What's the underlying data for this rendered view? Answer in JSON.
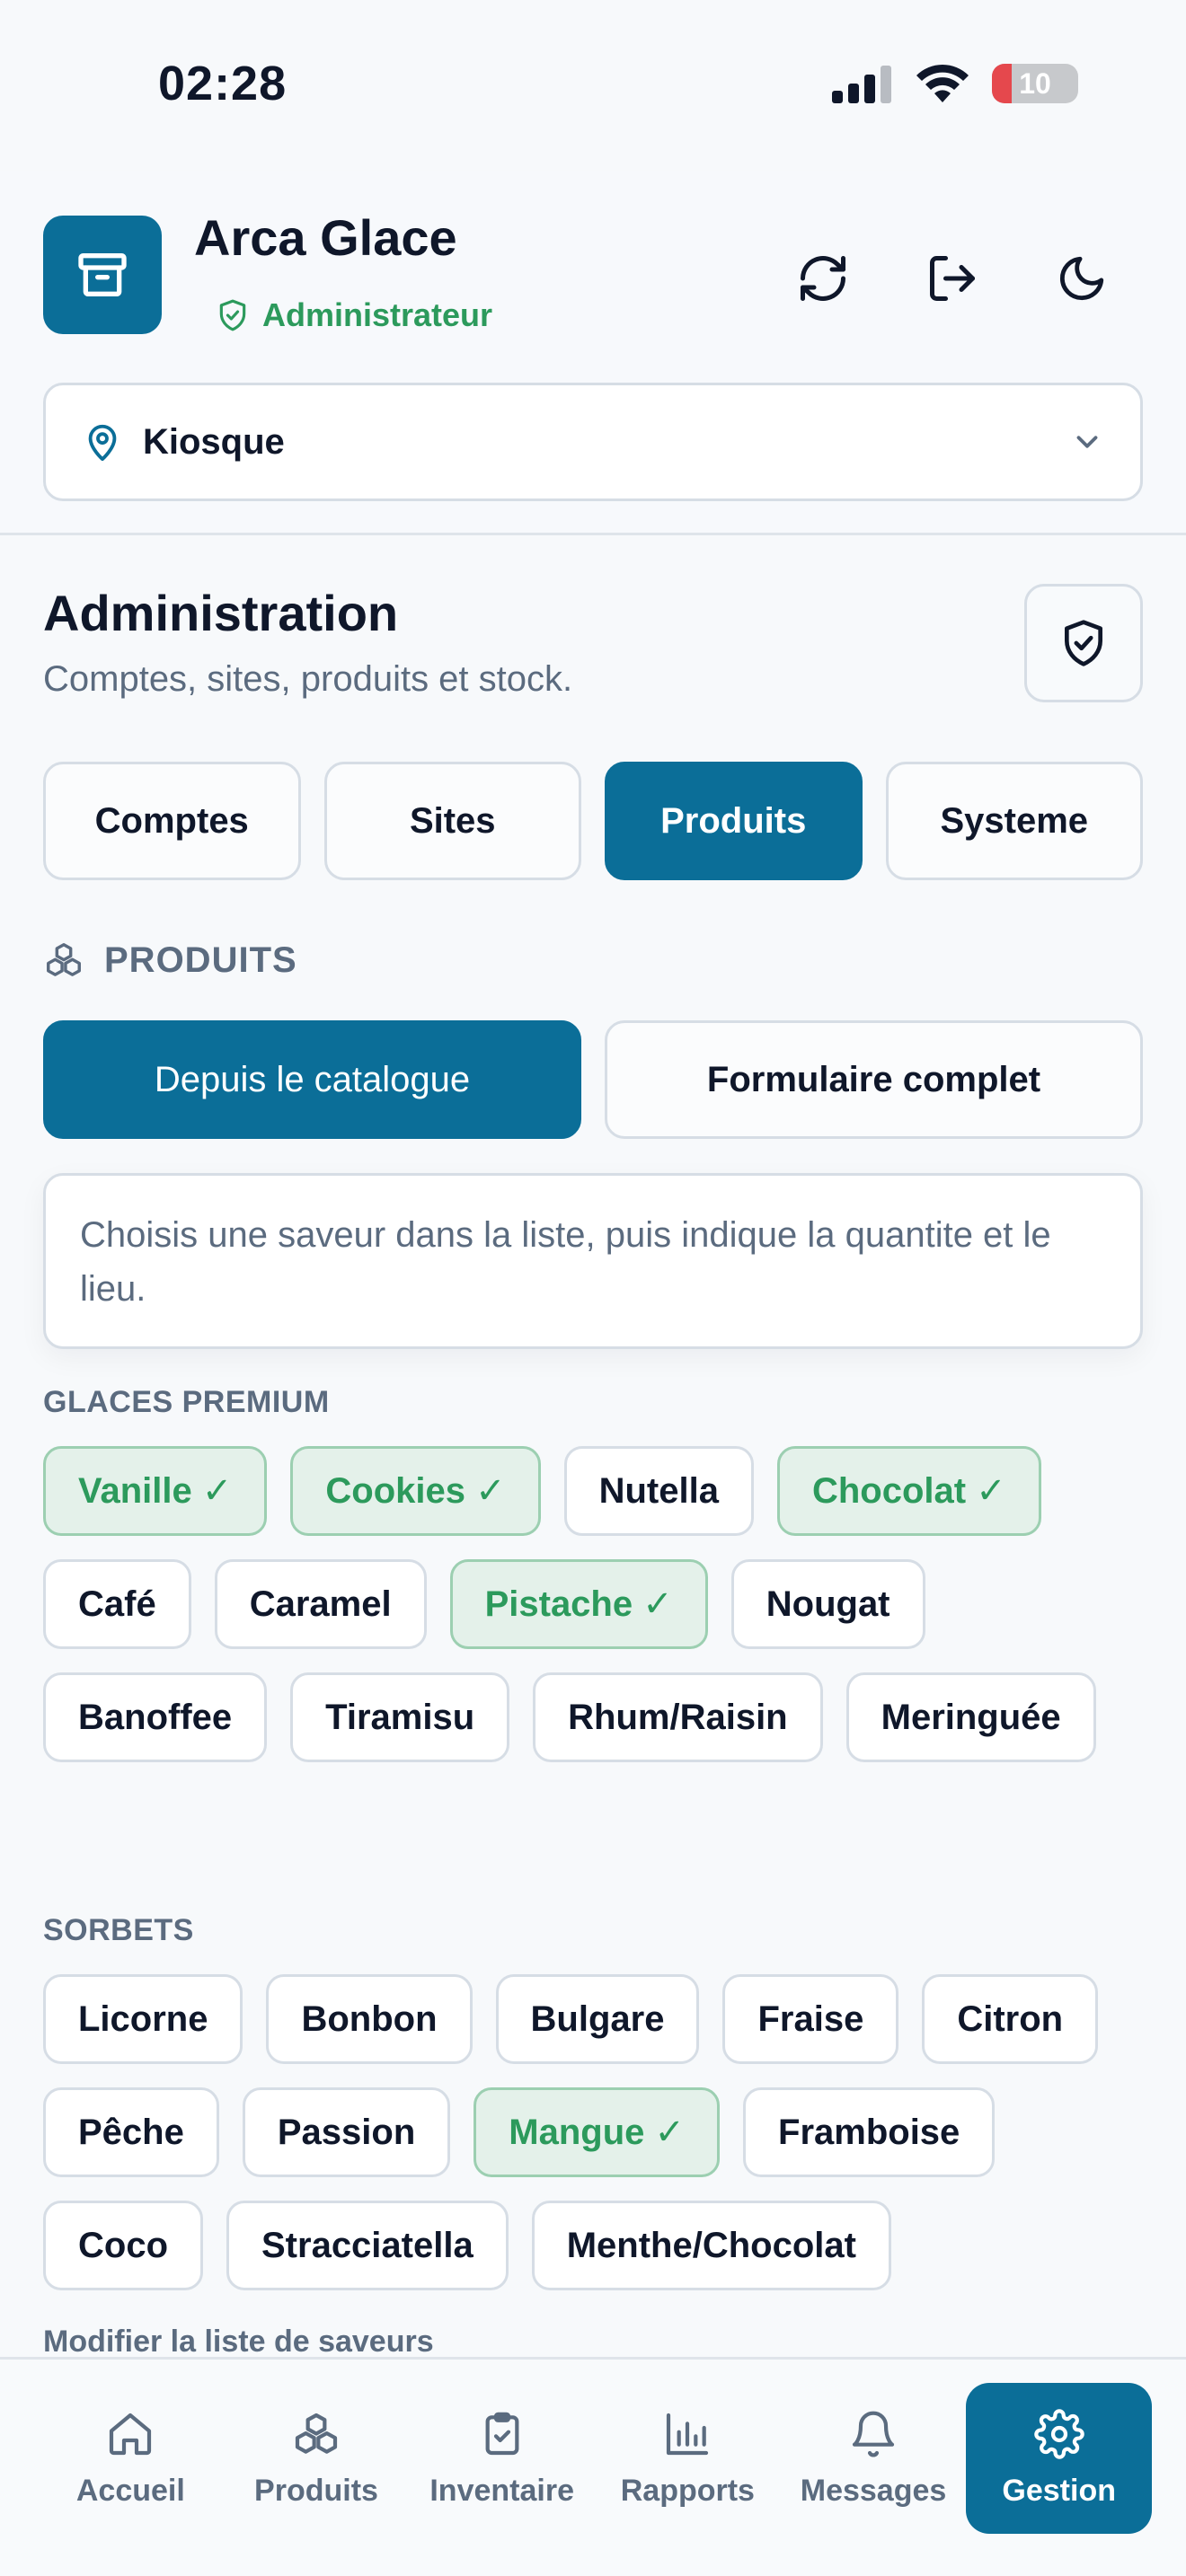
{
  "status": {
    "time": "02:28",
    "battery": "10"
  },
  "header": {
    "app_name": "Arca Glace",
    "role": "Administrateur",
    "site": "Kiosque"
  },
  "admin": {
    "title": "Administration",
    "subtitle": "Comptes, sites, produits et stock.",
    "tabs": [
      {
        "label": "Comptes"
      },
      {
        "label": "Sites"
      },
      {
        "label": "Produits"
      },
      {
        "label": "Systeme"
      }
    ],
    "active_tab": "Produits"
  },
  "produits": {
    "section_title": "PRODUITS",
    "modes": [
      {
        "label": "Depuis le catalogue"
      },
      {
        "label": "Formulaire complet"
      }
    ],
    "hint": "Choisis une saveur dans la liste, puis indique la quantite et le lieu.",
    "premium_label": "GLACES PREMIUM",
    "premium": [
      {
        "label": "Vanille ✓",
        "selected": true
      },
      {
        "label": "Cookies ✓",
        "selected": true
      },
      {
        "label": "Nutella",
        "selected": false
      },
      {
        "label": "Chocolat ✓",
        "selected": true
      },
      {
        "label": "Café",
        "selected": false
      },
      {
        "label": "Caramel",
        "selected": false
      },
      {
        "label": "Pistache ✓",
        "selected": true
      },
      {
        "label": "Nougat",
        "selected": false
      },
      {
        "label": "Banoffee",
        "selected": false
      },
      {
        "label": "Tiramisu",
        "selected": false
      },
      {
        "label": "Rhum/Raisin",
        "selected": false
      },
      {
        "label": "Meringuée",
        "selected": false
      }
    ],
    "sorbets_label": "SORBETS",
    "sorbets": [
      {
        "label": "Licorne",
        "selected": false
      },
      {
        "label": "Bonbon",
        "selected": false
      },
      {
        "label": "Bulgare",
        "selected": false
      },
      {
        "label": "Fraise",
        "selected": false
      },
      {
        "label": "Citron",
        "selected": false
      },
      {
        "label": "Pêche",
        "selected": false
      },
      {
        "label": "Passion",
        "selected": false
      },
      {
        "label": "Mangue ✓",
        "selected": true
      },
      {
        "label": "Framboise",
        "selected": false
      },
      {
        "label": "Coco",
        "selected": false
      },
      {
        "label": "Stracciatella",
        "selected": false
      },
      {
        "label": "Menthe/Chocolat",
        "selected": false
      }
    ],
    "edit_link": "Modifier la liste de saveurs"
  },
  "nav": [
    {
      "label": "Accueil",
      "icon": "home-icon"
    },
    {
      "label": "Produits",
      "icon": "boxes-icon"
    },
    {
      "label": "Inventaire",
      "icon": "clipboard-check-icon"
    },
    {
      "label": "Rapports",
      "icon": "bar-chart-icon"
    },
    {
      "label": "Messages",
      "icon": "bell-icon"
    },
    {
      "label": "Gestion",
      "icon": "gear-icon"
    }
  ],
  "colors": {
    "primary": "#0b6e98",
    "success": "#2c9a5c",
    "muted": "#5b6b7f"
  }
}
